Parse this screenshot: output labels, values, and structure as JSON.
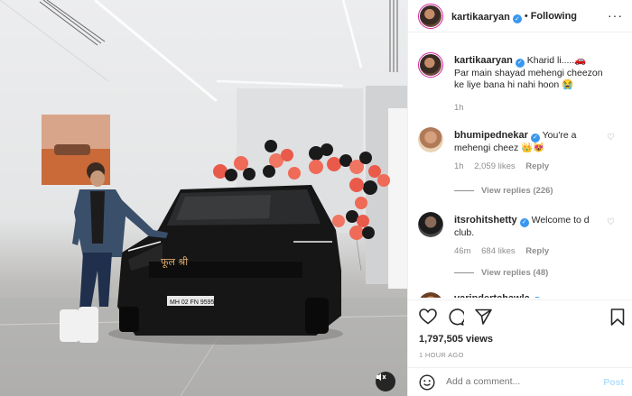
{
  "post": {
    "author": "kartikaaryan",
    "follow_state": "Following",
    "separator": "•",
    "more_icon": "more-horizontal-icon"
  },
  "caption": {
    "username": "kartikaaryan",
    "text": "Kharid li.....🚗\nPar main shayad mehengi cheezon ke liye bana hi nahi hoon 😭",
    "time": "1h"
  },
  "comments": [
    {
      "username": "bhumipednekar",
      "text": "You're a mehengi cheez 👑😻",
      "time": "1h",
      "likes": "2,059 likes",
      "reply": "Reply",
      "view_replies": "View replies (226)"
    },
    {
      "username": "itsrohitshetty",
      "text": "Welcome to d club.",
      "time": "46m",
      "likes": "684 likes",
      "reply": "Reply",
      "view_replies": "View replies (48)"
    },
    {
      "username": "varindertchawla"
    }
  ],
  "stats": {
    "views": "1,797,505 views",
    "posted": "1 HOUR AGO"
  },
  "composer": {
    "placeholder": "Add a comment...",
    "post_label": "Post"
  },
  "photo": {
    "plate": "MH 02 FN 9595",
    "mute_icon": "speaker-muted-icon"
  },
  "colors": {
    "link": "#3897f0",
    "muted": "#8e8e8e",
    "post_disabled": "#b2dffc"
  }
}
